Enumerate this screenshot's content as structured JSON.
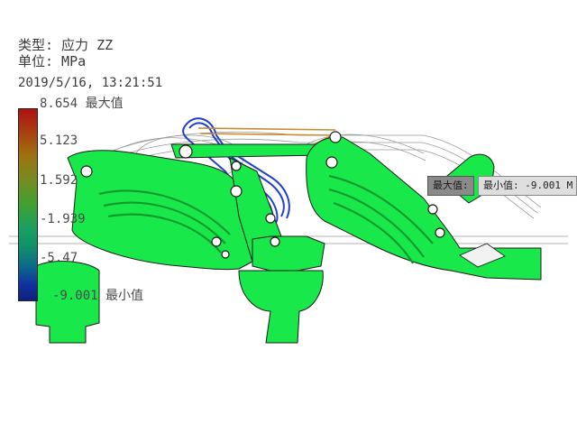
{
  "header": {
    "type_line": "类型: 应力 ZZ",
    "unit_line": "单位: MPa",
    "timestamp": "2019/5/16, 13:21:51"
  },
  "legend": {
    "max_label": "8.654 最大值",
    "ticks": [
      "5.123",
      "1.592",
      "-1.939",
      "-5.47"
    ],
    "min_label": "-9.001 最小值"
  },
  "probes": {
    "max_tag": "最大值:",
    "min_tag": "最小值: -9.001 M"
  },
  "colors": {
    "part_fill": "#19e84a",
    "part_dark": "#0f9a2e",
    "edge": "#1b1b1b",
    "link_blue": "#1f3fd0",
    "link_orange": "#c98a30"
  }
}
